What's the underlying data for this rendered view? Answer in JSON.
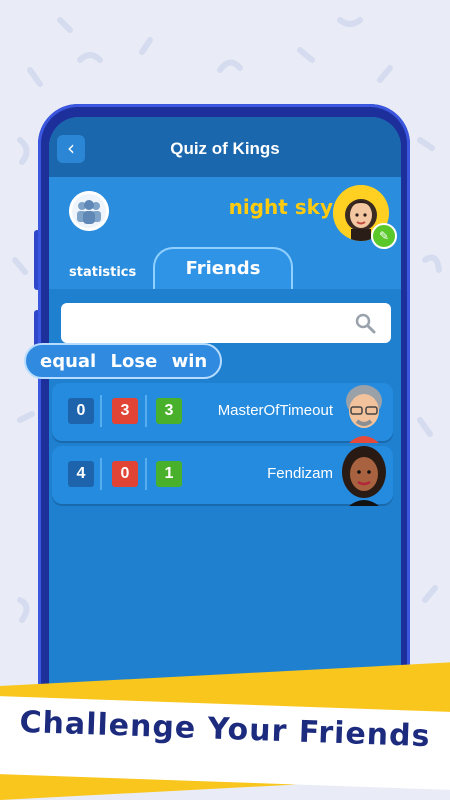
{
  "app": {
    "title": "Quiz of Kings"
  },
  "header": {
    "back_icon": "back-arrow-icon"
  },
  "profile": {
    "name": "night sky",
    "group_icon": "friends-group-icon",
    "edit_icon": "pencil-icon"
  },
  "tabs": [
    {
      "label": "statistics"
    },
    {
      "label": "Friends",
      "active": true
    }
  ],
  "search": {
    "placeholder": "",
    "icon": "search-icon"
  },
  "legend": {
    "equal": "equal",
    "lose": "Lose",
    "win": "win"
  },
  "friends": [
    {
      "name": "MasterOfTimeout",
      "equal": "0",
      "lose": "3",
      "win": "3"
    },
    {
      "name": "Fendizam",
      "equal": "4",
      "lose": "0",
      "win": "1"
    }
  ],
  "banner": {
    "text": "Challenge Your Friends"
  },
  "colors": {
    "accent": "#1f80d0",
    "lose": "#e14335",
    "win": "#49b02b",
    "equal": "#1d64ad",
    "name_yellow": "#ffcb0f",
    "banner_yellow": "#f8c61c"
  }
}
